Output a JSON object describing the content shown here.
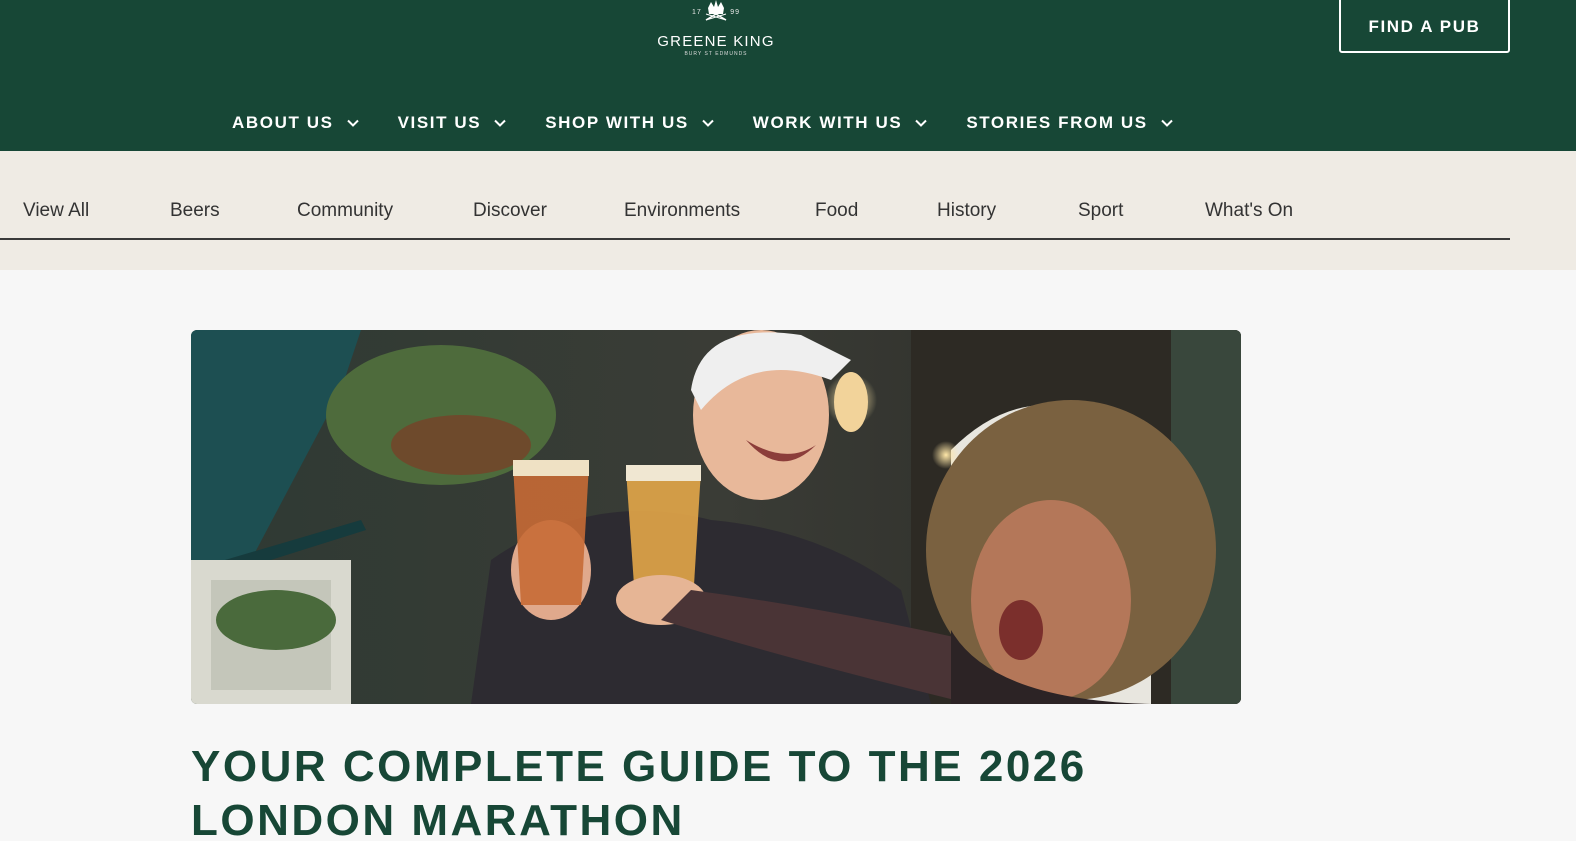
{
  "header": {
    "logo_year_left": "17",
    "logo_year_right": "99",
    "logo_name": "GREENE KING",
    "logo_sub": "BURY ST EDMUNDS",
    "find_pub_label": "FIND A PUB"
  },
  "main_nav": [
    {
      "label": "ABOUT US",
      "icon": "chevron-down-icon"
    },
    {
      "label": "VISIT US",
      "icon": "chevron-down-icon"
    },
    {
      "label": "SHOP WITH US",
      "icon": "chevron-down-icon"
    },
    {
      "label": "WORK WITH US",
      "icon": "chevron-down-icon"
    },
    {
      "label": "STORIES FROM US",
      "icon": "chevron-down-icon"
    }
  ],
  "categories": [
    {
      "label": "View All"
    },
    {
      "label": "Beers"
    },
    {
      "label": "Community"
    },
    {
      "label": "Discover"
    },
    {
      "label": "Environments"
    },
    {
      "label": "Food"
    },
    {
      "label": "History"
    },
    {
      "label": "Sport"
    },
    {
      "label": "What's On"
    }
  ],
  "article": {
    "title": "YOUR COMPLETE GUIDE TO THE 2026 LONDON MARATHON"
  },
  "colors": {
    "brand_green": "#174736",
    "category_bar": "#efebe4",
    "page_bg": "#f7f7f7"
  }
}
